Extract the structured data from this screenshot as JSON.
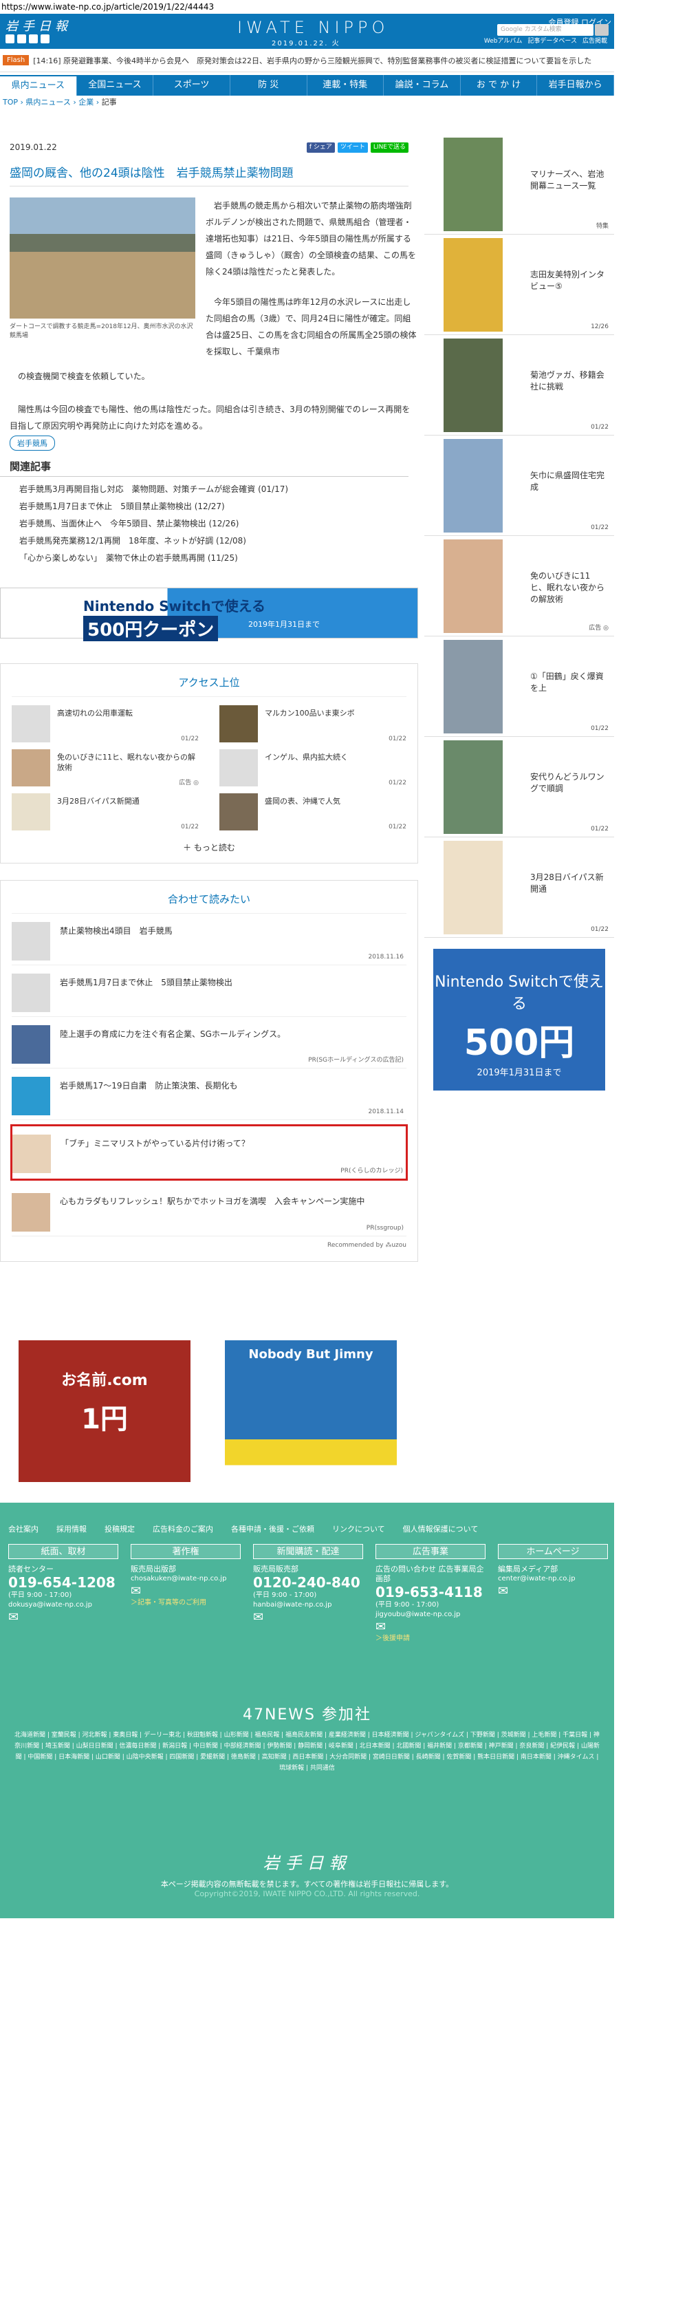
{
  "url": "https://www.iwate-np.co.jp/article/2019/1/22/44443",
  "header": {
    "logo": "岩手日報",
    "masthead": "IWATE NIPPO",
    "date": "2019.01.22. 火",
    "user_links": "会員登録 ログイン",
    "search_placeholder": "Google カスタム検索",
    "sub_links": [
      "Webアルバム",
      "記事データベース",
      "広告掲載"
    ]
  },
  "flash": {
    "tag": "Flash",
    "text": "[14:16] 原発避難事業、今後4時半から会見へ　原発対策会は22日、岩手県内の野から三陸観光振興で、特別監督業務事件の被災者に検証措置について要旨を示した"
  },
  "nav": [
    "県内ニュース",
    "全国ニュース",
    "スポーツ",
    "防 災",
    "連載・特集",
    "論説・コラム",
    "お で か け",
    "岩手日報から"
  ],
  "breadcrumb": [
    "TOP",
    "県内ニュース",
    "企業",
    "記事"
  ],
  "article": {
    "date": "2019.01.22",
    "share": [
      "f シェア",
      "ツイート",
      "LINEで送る"
    ],
    "title": "盛岡の厩舎、他の24頭は陰性　岩手競馬禁止薬物問題",
    "caption": "ダートコースで調教する競走馬=2018年12月、奥州市水沢の水沢競馬場",
    "p1": "岩手競馬の競走馬から相次いで禁止薬物の筋肉増強剤ボルデノンが検出された問題で、県競馬組合（管理者・達増拓也知事）は21日、今年5頭目の陽性馬が所属する盛岡（きゅうしゃ）（厩舎）の全頭検査の結果、この馬を除く24頭は陰性だったと発表した。",
    "p2": "今年5頭目の陽性馬は昨年12月の水沢レースに出走した同組合の馬（3歳）で、同月24日に陽性が確定。同組合は盛25日、この馬を含む同組合の所属馬全25頭の検体を採取し、千葉県市",
    "p3": "の検査機関で検査を依頼していた。",
    "p4": "陽性馬は今回の検査でも陽性、他の馬は陰性だった。同組合は引き続き、3月の特別開催でのレース再開を目指して原因究明や再発防止に向けた対応を進める。",
    "tag": "岩手競馬"
  },
  "related": {
    "heading": "関連記事",
    "items": [
      "岩手競馬3月再開目指し対応　薬物問題、対策チームが総会確資 (01/17)",
      "岩手競馬1月7日まで休止　5頭目禁止薬物検出 (12/27)",
      "岩手競馬、当面休止へ　今年5頭目、禁止薬物検出 (12/26)",
      "岩手競馬発売業務12/1再開　18年度、ネットが好調 (12/08)",
      "「心から楽しめない」　薬物で休止の岩手競馬再開 (11/25)"
    ]
  },
  "ad_banner": {
    "line1": "Nintendo Switchで使える",
    "line2": "500円クーポン",
    "line3": "2019年1月31日まで"
  },
  "ranking": {
    "heading": "アクセス上位",
    "items": [
      {
        "title": "高速切れの公用車運転",
        "date": "01/22"
      },
      {
        "title": "マルカン100品いま東シボ",
        "date": "01/22"
      },
      {
        "title": "免のいびきに11ヒ、眠れない夜からの解放術",
        "date": "広告 ◎"
      },
      {
        "title": "インゲル、県内拡大続く",
        "date": "01/22"
      },
      {
        "title": "3月28日バイパス新開通",
        "date": "01/22"
      },
      {
        "title": "盛岡の表、沖縄で人気",
        "date": "01/22"
      }
    ],
    "more": "もっと読む"
  },
  "recommend": {
    "heading": "合わせて読みたい",
    "items": [
      {
        "title": "禁止薬物検出4頭目　岩手競馬",
        "date": "2018.11.16"
      },
      {
        "title": "岩手競馬1月7日まで休止　5頭目禁止薬物検出",
        "date": ""
      },
      {
        "title": "陸上選手の育成に力を注ぐ有名企業、SGホールディングス。",
        "date": "PR(SGホールディングスの広告記)"
      },
      {
        "title": "岩手競馬17～19日自粛　防止策決策、長期化も",
        "date": "2018.11.14"
      },
      {
        "title": "「ブチ」ミニマリストがやっている片付け術って？",
        "date": "PR(くらしのカレッジ)"
      },
      {
        "title": "心もカラダもリフレッシュ！駅ちかでホットヨガを満喫　入会キャンペーン実施中",
        "date": "PR(ssgroup)"
      }
    ],
    "credit": "Recommended by ⁂uzou"
  },
  "ads_bottom": {
    "left_t1": "お名前.com",
    "left_t2": "1円",
    "right_t1": "Nobody But Jimny"
  },
  "side": [
    {
      "title": "マリナーズへ、岩池開幕ニュース一覧",
      "date": "特集"
    },
    {
      "title": "志田友美特別インタビュー⑤",
      "date": "12/26"
    },
    {
      "title": "菊池ヴァガ、移籍会社に挑戦",
      "date": "01/22"
    },
    {
      "title": "矢巾に県盛岡住宅完成",
      "date": "01/22"
    },
    {
      "title": "免のいびきに11ヒ、眠れない夜からの解放術",
      "date": "広告 ◎"
    },
    {
      "title": "①「田鶴」戻く爆資を上",
      "date": "01/22"
    },
    {
      "title": "安代りんどうルワングで順調",
      "date": "01/22"
    },
    {
      "title": "3月28日バイパス新開通",
      "date": "01/22"
    }
  ],
  "side_ad": {
    "line1": "Nintendo Switchで使える",
    "line2": "500円",
    "line3": "2019年1月31日まで"
  },
  "footer": {
    "links": [
      "会社案内",
      "採用情報",
      "投稿規定",
      "広告料金のご案内",
      "各種申請・後援・ご依頼",
      "リンクについて",
      "個人情報保護について"
    ],
    "cols": [
      {
        "head": "紙面、取材",
        "sub": "読者センター",
        "phone": "019-654-1208",
        "hours": "(平日 9:00 - 17:00)",
        "mail": "dokusya@iwate-np.co.jp"
      },
      {
        "head": "著作権",
        "sub": "販売局出版部",
        "phone": "",
        "hours": "",
        "mail": "chosakuken@iwate-np.co.jp",
        "note": "＞記事・写真等のご利用"
      },
      {
        "head": "新聞購読・配達",
        "sub": "販売局販売部",
        "phone": "0120-240-840",
        "hours": "(平日 9:00 - 17:00)",
        "mail": "hanbai@iwate-np.co.jp"
      },
      {
        "head": "広告事業",
        "sub": "広告の問い合わせ 広告事業局企画部",
        "phone": "019-653-4118",
        "hours": "(平日 9:00 - 17:00)",
        "mail": "jigyoubu@iwate-np.co.jp",
        "note": "＞後援申請"
      },
      {
        "head": "ホームページ",
        "sub": "編集局メディア部",
        "phone": "",
        "hours": "",
        "mail": "center@iwate-np.co.jp"
      }
    ],
    "news47": "47NEWS 参加社",
    "news47_list": "北海道新聞 | 室蘭民報 | 河北新報 | 東奥日報 | デーリー東北 | 秋田魁新報 | 山形新聞 | 福島民報 | 福島民友新聞 | 産業経済新聞 | 日本経済新聞 | ジャパンタイムズ | 下野新聞 | 茨城新聞 | 上毛新聞 | 千葉日報 | 神奈川新聞 | 埼玉新聞 | 山梨日日新聞 | 信濃毎日新聞 | 新潟日報 | 中日新聞 | 中部経済新聞 | 伊勢新聞 | 静岡新聞 | 岐阜新聞 | 北日本新聞 | 北國新聞 | 福井新聞 | 京都新聞 | 神戸新聞 | 奈良新聞 | 紀伊民報 | 山陽新聞 | 中国新聞 | 日本海新聞 | 山口新聞 | 山陰中央新報 | 四国新聞 | 愛媛新聞 | 徳島新聞 | 高知新聞 | 西日本新聞 | 大分合同新聞 | 宮崎日日新聞 | 長崎新聞 | 佐賀新聞 | 熊本日日新聞 | 南日本新聞 | 沖縄タイムス | 琉球新報 | 共同通信",
    "logo": "岩手日報",
    "copy1": "本ページ掲載内容の無断転載を禁じます。すべての著作権は岩手日報社に帰属します。",
    "copy2": "Copyright©2019, IWATE NIPPO CO.,LTD. All rights reserved."
  },
  "colors": {
    "brand": "#0b76b8",
    "footer": "#4cb59a",
    "flash": "#e46b1e",
    "highlight": "#d51f1f"
  }
}
